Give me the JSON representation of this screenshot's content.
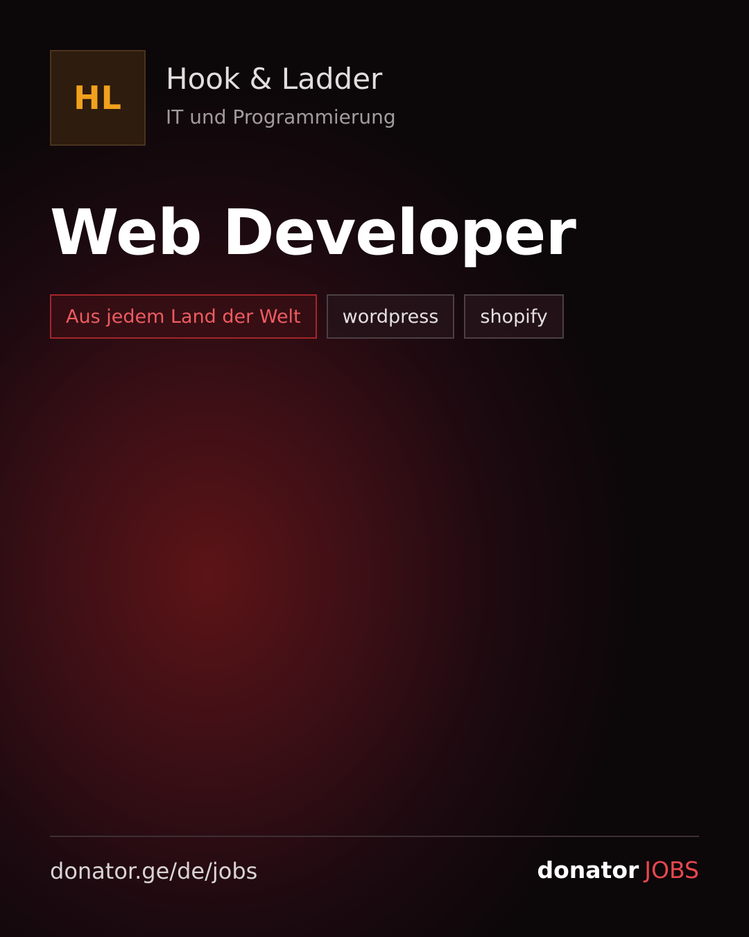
{
  "company": {
    "logo_initials": "HL",
    "name": "Hook & Ladder",
    "category": "IT und Programmierung"
  },
  "job": {
    "title": "Web Developer",
    "tags": [
      {
        "label": "Aus jedem Land der Welt",
        "kind": "location"
      },
      {
        "label": "wordpress",
        "kind": "skill"
      },
      {
        "label": "shopify",
        "kind": "skill"
      }
    ]
  },
  "footer": {
    "url": "donator.ge/de/jobs",
    "brand_main": "donator",
    "brand_accent": "JOBS"
  },
  "colors": {
    "accent_red": "#e8484e",
    "logo_orange": "#f2a11d",
    "background_glow": "#5c1417",
    "background_dark": "#0c0709"
  }
}
